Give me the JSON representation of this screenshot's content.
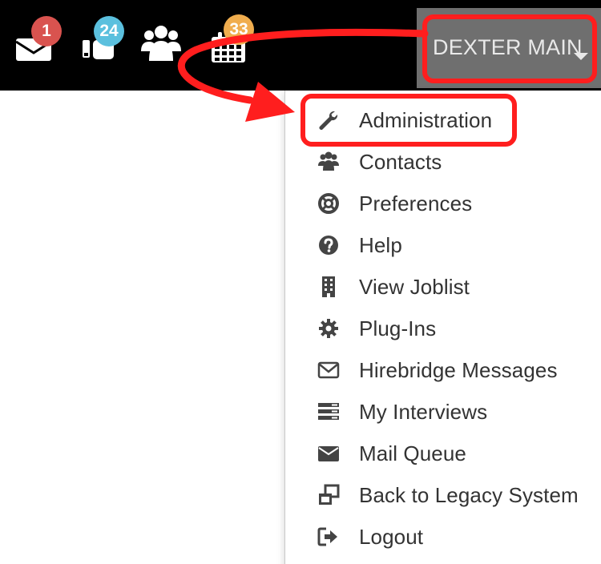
{
  "topbar": {
    "icons": [
      {
        "name": "mail-icon",
        "badge": "1",
        "badge_color": "#d9534f"
      },
      {
        "name": "tasks-icon",
        "badge": "24",
        "badge_color": "#5bc0de"
      },
      {
        "name": "users-icon",
        "badge": null
      },
      {
        "name": "calendar-icon",
        "badge": "33",
        "badge_color": "#f0ad4e"
      }
    ],
    "user": {
      "name": "DEXTER MAIN"
    }
  },
  "dropdown": {
    "items": [
      {
        "label": "Administration",
        "icon": "wrench-icon"
      },
      {
        "label": "Contacts",
        "icon": "users-icon"
      },
      {
        "label": "Preferences",
        "icon": "life-ring-icon"
      },
      {
        "label": "Help",
        "icon": "question-circle-icon"
      },
      {
        "label": "View Joblist",
        "icon": "building-icon"
      },
      {
        "label": "Plug-Ins",
        "icon": "gear-icon"
      },
      {
        "label": "Hirebridge Messages",
        "icon": "envelope-outline-icon"
      },
      {
        "label": "My Interviews",
        "icon": "list-icon"
      },
      {
        "label": "Mail Queue",
        "icon": "envelope-icon"
      },
      {
        "label": "Back to Legacy System",
        "icon": "windows-icon"
      },
      {
        "label": "Logout",
        "icon": "sign-out-icon"
      }
    ]
  },
  "annotation": {
    "color": "#ff1e1e"
  }
}
